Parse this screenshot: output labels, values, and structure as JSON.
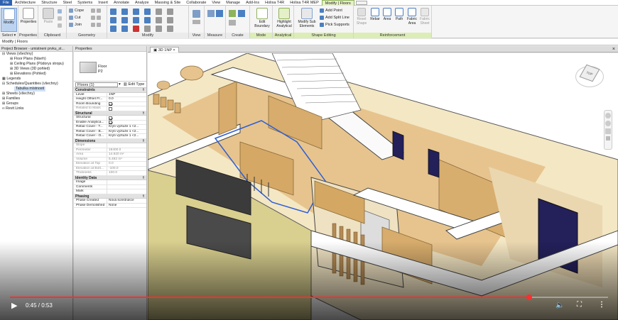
{
  "tabs": [
    "File",
    "Architecture",
    "Structure",
    "Steel",
    "Systems",
    "Insert",
    "Annotate",
    "Analyze",
    "Massing & Site",
    "Collaborate",
    "View",
    "Manage",
    "Add-Ins",
    "Holixa T4R",
    "Holixa T4R MEP",
    "Modify | Floors"
  ],
  "ribbon": {
    "modify": {
      "label": "Modify",
      "title": "Select ▾"
    },
    "properties": {
      "label": "Properties",
      "title": "Properties"
    },
    "clipboard": {
      "paste": "Paste",
      "title": "Clipboard"
    },
    "geometry": {
      "cope": "Cope",
      "cut": "Cut",
      "join": "Join",
      "title": "Geometry"
    },
    "modify_group": {
      "title": "Modify"
    },
    "view_group": {
      "title": "View"
    },
    "measure_group": {
      "title": "Measure"
    },
    "create_group": {
      "title": "Create"
    },
    "mode": {
      "edit_boundary": "Edit Boundary",
      "title": "Mode"
    },
    "analytical": {
      "highlight": "Highlight Analytical",
      "title": "Analytical"
    },
    "shape_editing": {
      "modify_sub": "Modify Sub Elements",
      "add_point": "Add Point",
      "add_split": "Add Split Line",
      "pick_supports": "Pick Supports",
      "title": "Shape Editing"
    },
    "reinforcement": {
      "reset_shape": "Reset Shape",
      "rebar": "Rebar",
      "area": "Area",
      "path": "Path",
      "fabric_area": "Fabric Area",
      "fabric_sheet": "Fabric Sheet",
      "title": "Reinforcement"
    }
  },
  "context_bar": "Modify | Floors",
  "project_browser": {
    "title": "Project Browser - umistneni prvku_st...",
    "items": [
      {
        "text": "Views (všechny)",
        "level": "l1",
        "sym": "⊟"
      },
      {
        "text": "Floor Plans (Návrh)",
        "level": "l2",
        "sym": "⊞"
      },
      {
        "text": "Ceiling Plans (Půdorys stropu)",
        "level": "l2",
        "sym": "⊞"
      },
      {
        "text": "3D Views (3D pohled)",
        "level": "l2",
        "sym": "⊞"
      },
      {
        "text": "Elevations (Pohled)",
        "level": "l2",
        "sym": "⊞"
      },
      {
        "text": "Legends",
        "level": "l1",
        "sym": "▦"
      },
      {
        "text": "Schedules/Quantities (všechny)",
        "level": "l1",
        "sym": "⊟"
      },
      {
        "text": "Tabulka místností",
        "level": "l3",
        "sym": "",
        "hl": true
      },
      {
        "text": "Sheets (všechny)",
        "level": "l1",
        "sym": "⊞"
      },
      {
        "text": "Families",
        "level": "l1",
        "sym": "⊞"
      },
      {
        "text": "Groups",
        "level": "l1",
        "sym": "⊞"
      },
      {
        "text": "Revit Links",
        "level": "l1",
        "sym": "∞"
      }
    ]
  },
  "properties": {
    "title": "Properties",
    "type_line1": "Floor",
    "type_line2": "P2",
    "selector": "Floors (1)",
    "edit_type": "Edit Type",
    "sections": [
      {
        "name": "Constraints",
        "rows": [
          {
            "k": "Level",
            "v": "1NP"
          },
          {
            "k": "Height Offset Fr...",
            "v": "0.0"
          },
          {
            "k": "Room Bounding",
            "v": "",
            "cb": true
          },
          {
            "k": "Related to Mass",
            "v": "",
            "cb": false,
            "ro": true
          }
        ]
      },
      {
        "name": "Structural",
        "rows": [
          {
            "k": "Structural",
            "v": "",
            "cb": true
          },
          {
            "k": "Enable Analytica...",
            "v": "",
            "cb": true
          },
          {
            "k": "Rebar Cover - T...",
            "v": "Krytí výztuže 1 <2..."
          },
          {
            "k": "Rebar Cover - B...",
            "v": "Krytí výztuže 1 <2..."
          },
          {
            "k": "Rebar Cover - O...",
            "v": "Krytí výztuže 1 <2..."
          }
        ]
      },
      {
        "name": "Dimensions",
        "rows": [
          {
            "k": "Slope",
            "v": "",
            "ro": true
          },
          {
            "k": "Perimeter",
            "v": "18400.0",
            "ro": true
          },
          {
            "k": "Area",
            "v": "14.920 m²",
            "ro": true
          },
          {
            "k": "Volume",
            "v": "5.492 m³",
            "ro": true
          },
          {
            "k": "Elevation at Top",
            "v": "0.0",
            "ro": true
          },
          {
            "k": "Elevation at Bott...",
            "v": "-100.0",
            "ro": true
          },
          {
            "k": "Thickness",
            "v": "100.0",
            "ro": true
          }
        ]
      },
      {
        "name": "Identity Data",
        "rows": [
          {
            "k": "Image",
            "v": ""
          },
          {
            "k": "Comments",
            "v": ""
          },
          {
            "k": "Mark",
            "v": ""
          }
        ]
      },
      {
        "name": "Phasing",
        "rows": [
          {
            "k": "Phase Created",
            "v": "Nová konstrukce"
          },
          {
            "k": "Phase Demolished",
            "v": "None"
          }
        ]
      }
    ]
  },
  "view_tab": "3D 1NP",
  "viewcube_label": "TOP",
  "video": {
    "time": "0:45 / 0:53",
    "progress": 0.868
  },
  "colors": {
    "accent": "#2f63b0",
    "context": "#dcedb5",
    "progress": "#ff2d2d"
  }
}
